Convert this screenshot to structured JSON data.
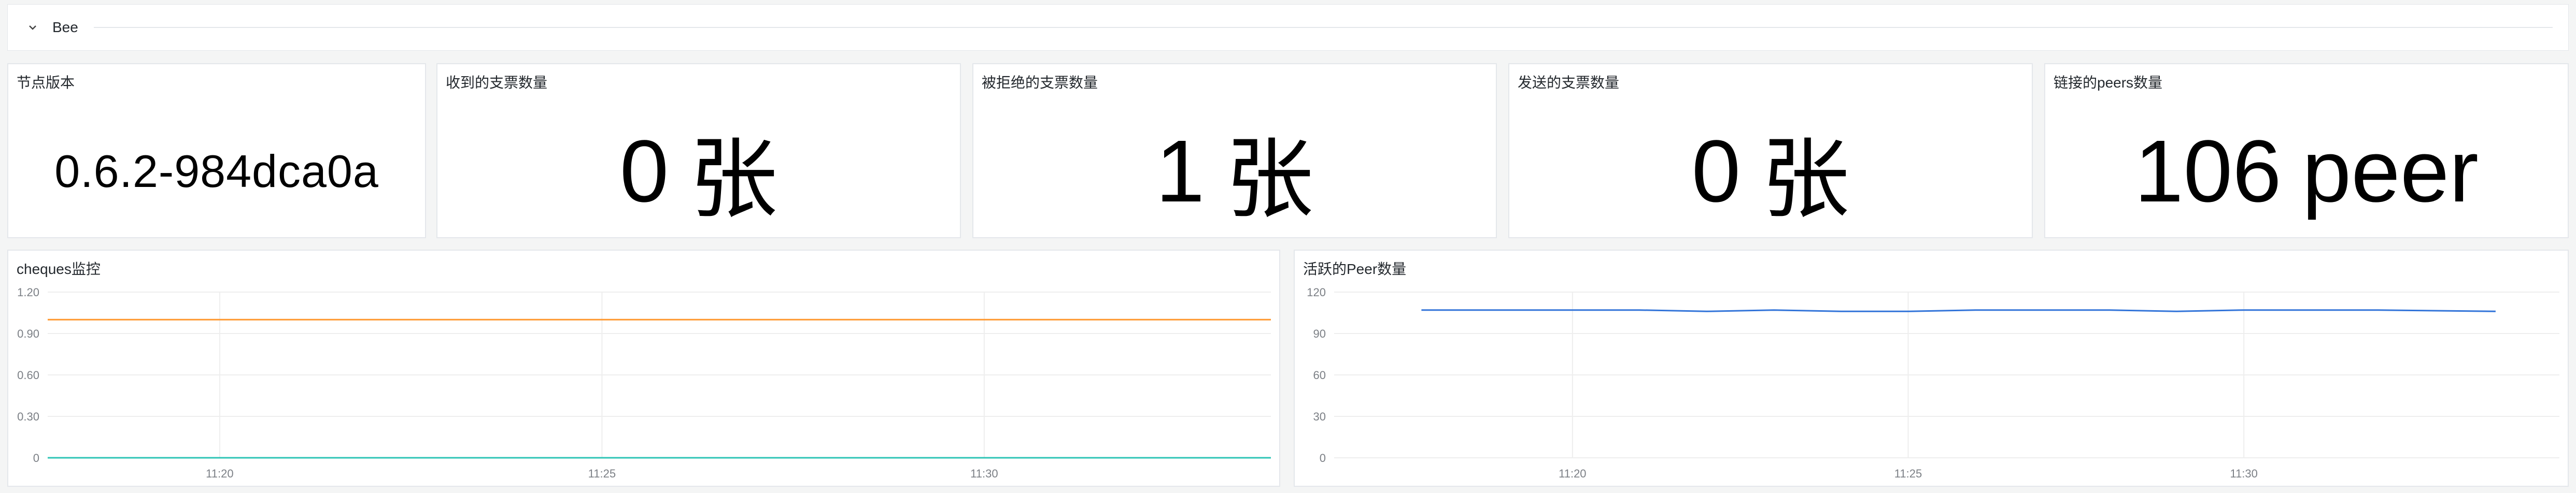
{
  "row": {
    "title": "Bee",
    "icon": "chevron-down-icon"
  },
  "stats": [
    {
      "title": "节点版本",
      "value": "0.6.2-984dca0a",
      "unit": ""
    },
    {
      "title": "收到的支票数量",
      "value": "0",
      "unit": "张"
    },
    {
      "title": "被拒绝的支票数量",
      "value": "1",
      "unit": "张"
    },
    {
      "title": "发送的支票数量",
      "value": "0",
      "unit": "张"
    },
    {
      "title": "链接的peers数量",
      "value": "106",
      "unit": "peer"
    }
  ],
  "chart_data": [
    {
      "type": "line",
      "title": "cheques监控",
      "x_ticks": [
        "11:20",
        "11:25",
        "11:30"
      ],
      "y_ticks": [
        "0",
        "0.30",
        "0.60",
        "0.90",
        "1.20"
      ],
      "ylim": [
        0,
        1.2
      ],
      "xlim": [
        "11:17:45",
        "11:33:45"
      ],
      "grid": true,
      "series": [
        {
          "color": "#ff9830",
          "x": [
            "11:17:45",
            "11:33:45"
          ],
          "values": [
            1,
            1
          ]
        },
        {
          "color": "#2ec4b6",
          "x": [
            "11:17:45",
            "11:33:45"
          ],
          "values": [
            0,
            0
          ]
        }
      ]
    },
    {
      "type": "line",
      "title": "活跃的Peer数量",
      "x_ticks": [
        "11:20",
        "11:25",
        "11:30"
      ],
      "y_ticks": [
        "0",
        "30",
        "60",
        "90",
        "120"
      ],
      "ylim": [
        0,
        120
      ],
      "xlim": [
        "11:16:27",
        "11:34:42"
      ],
      "grid": true,
      "series": [
        {
          "color": "#3274d9",
          "x": [
            "11:17:45",
            "11:19:00",
            "11:20:00",
            "11:21:00",
            "11:22:00",
            "11:23:00",
            "11:24:00",
            "11:25:00",
            "11:26:00",
            "11:27:00",
            "11:28:00",
            "11:29:00",
            "11:30:00",
            "11:31:00",
            "11:32:00",
            "11:33:45"
          ],
          "values": [
            107,
            107,
            107,
            107,
            106,
            107,
            106,
            106,
            107,
            107,
            107,
            106,
            107,
            107,
            107,
            106
          ]
        }
      ]
    }
  ],
  "colors": {
    "grid": "#eeeeee",
    "axis_text": "#7b7f85",
    "panel_border": "#e4e7eb"
  }
}
